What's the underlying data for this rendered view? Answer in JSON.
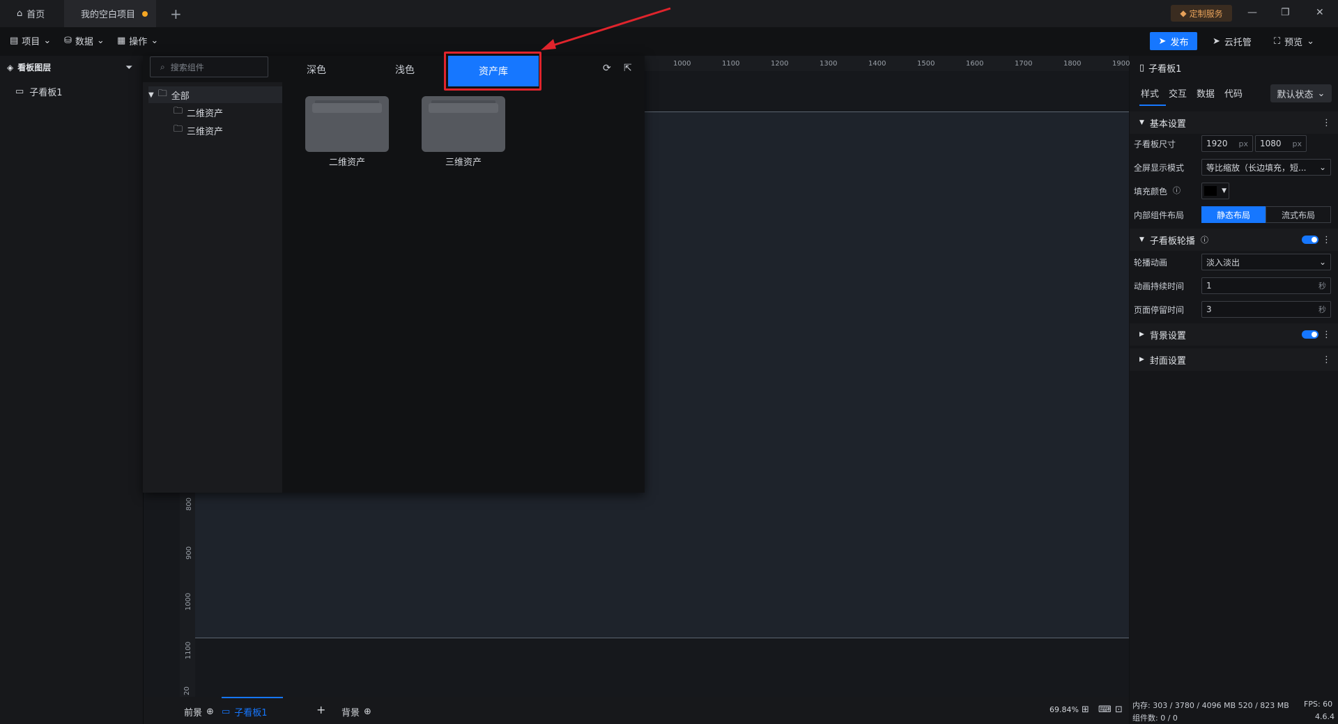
{
  "titlebar": {
    "home_tab": "首页",
    "project_tab": "我的空白项目",
    "custom_service": "定制服务",
    "new_tab": "+"
  },
  "toolbar": {
    "project_menu": "项目",
    "data_menu": "数据",
    "operation_menu": "操作",
    "publish": "发布",
    "cloud_hosting": "云托管",
    "preview": "预览"
  },
  "layers": {
    "title": "看板图层",
    "items": [
      "子看板1"
    ]
  },
  "asset_popup": {
    "search_placeholder": "搜索组件",
    "tabs": [
      "深色",
      "浅色",
      "资产库"
    ],
    "active_tab": "资产库",
    "tree": {
      "root": "全部",
      "children": [
        "二维资产",
        "三维资产"
      ]
    },
    "folders": [
      "二维资产",
      "三维资产"
    ]
  },
  "ruler": {
    "top_ticks": [
      "1000",
      "1100",
      "1200",
      "1300",
      "1400",
      "1500",
      "1600",
      "1700",
      "1800",
      "1900"
    ],
    "left_ticks": [
      "800",
      "900",
      "1000",
      "1100",
      "20"
    ]
  },
  "props": {
    "title": "子看板1",
    "tabs": [
      "样式",
      "交互",
      "数据",
      "代码"
    ],
    "state": "默认状态",
    "basic_section": "基本设置",
    "size_label": "子看板尺寸",
    "width": "1920",
    "height": "1080",
    "unit_px": "px",
    "fullscreen_label": "全屏显示模式",
    "fullscreen_value": "等比缩放（长边填充，短...",
    "fill_label": "填充颜色",
    "layout_label": "内部组件布局",
    "layout_static": "静态布局",
    "layout_flow": "流式布局",
    "carousel_section": "子看板轮播",
    "carousel_anim_label": "轮播动画",
    "carousel_anim_value": "淡入淡出",
    "anim_duration_label": "动画持续时间",
    "anim_duration_value": "1",
    "unit_sec": "秒",
    "stay_label": "页面停留时间",
    "stay_value": "3",
    "bg_section": "背景设置",
    "cover_section": "封面设置"
  },
  "bottom": {
    "foreground": "前景",
    "sub_board": "子看板1",
    "background": "背景",
    "zoom": "69.84%"
  },
  "status": {
    "memory": "内存:  303 / 3780 / 4096 MB  520 / 823 MB",
    "fps": "FPS:  60",
    "components": "组件数: 0 / 0",
    "version": "4.6.4"
  },
  "colors": {
    "accent": "#1677ff",
    "highlight": "#e0242c",
    "unsaved_dot": "#f5a623"
  }
}
